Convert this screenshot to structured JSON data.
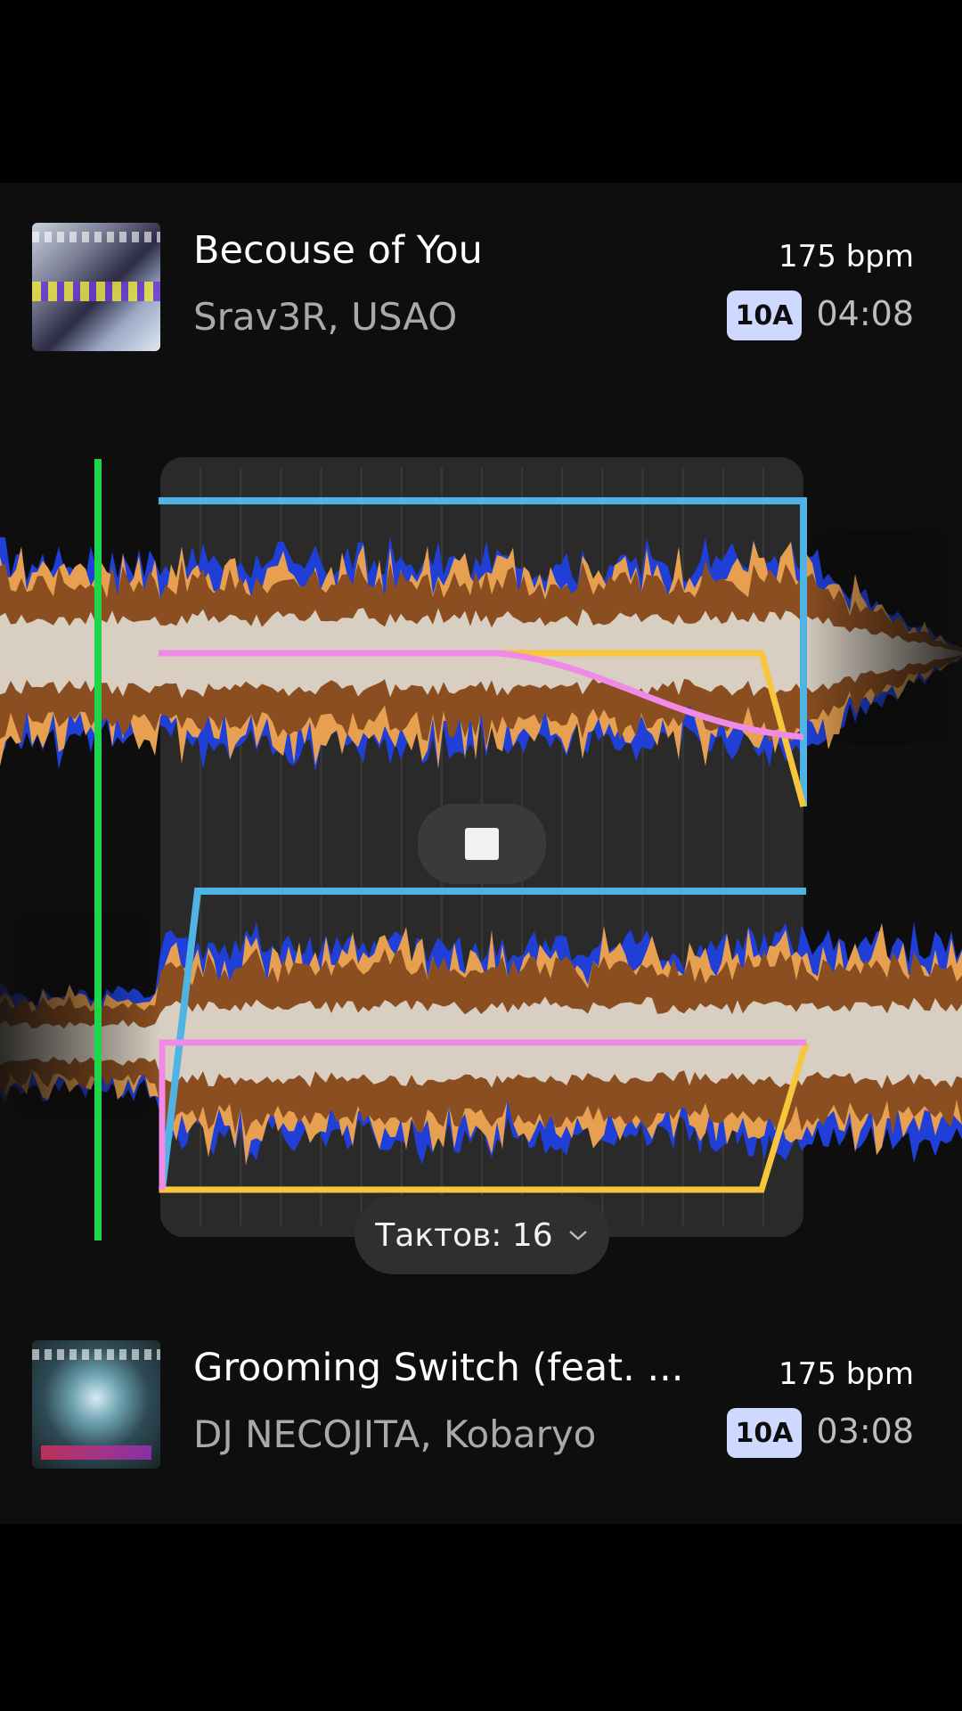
{
  "tracks": {
    "current": {
      "title": "Becouse of You",
      "artist": "Srav3R, USAO",
      "bpm": "175 bpm",
      "key": "10A",
      "duration": "04:08"
    },
    "next": {
      "title": "Grooming Switch (feat. ...",
      "artist": "DJ NECOJITA, Kobaryo",
      "bpm": "175 bpm",
      "key": "10A",
      "duration": "03:08"
    }
  },
  "transition": {
    "bars_label": "Тактов: 16",
    "bars": 16
  },
  "icons": {
    "stop": "stop-icon",
    "dropdown": "chevron-down-icon"
  },
  "colors": {
    "waveform_low": "#1f3fd6",
    "waveform_mid": "#8a4e21",
    "waveform_mid_light": "#e7a050",
    "waveform_high": "#d8cfc2",
    "playhead": "#1fd64a",
    "volume_curve": "#4fb4e3",
    "eq_low_curve": "#f7c63a",
    "eq_high_curve": "#f08ae6",
    "key_badge": "#cfd8ff"
  }
}
